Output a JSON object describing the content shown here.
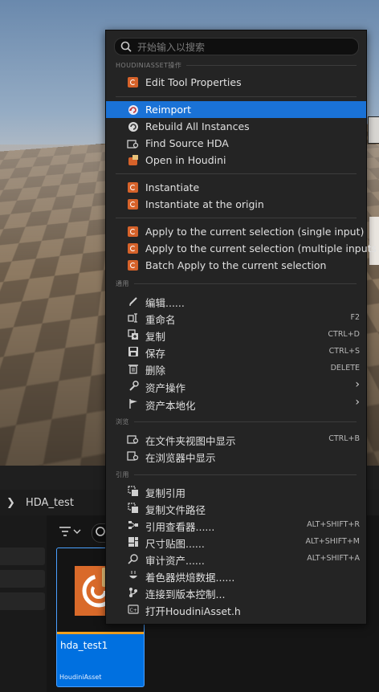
{
  "viewport": {},
  "content_browser": {
    "breadcrumb": "HDA_test",
    "asset": {
      "name": "hda_test1",
      "type": "HoudiniAsset"
    }
  },
  "menu": {
    "search_placeholder": "开始输入以搜索",
    "section_houdini": "HOUDINIASSET操作",
    "section_common": "通用",
    "section_browse": "浏览",
    "section_reference": "引用",
    "items": [
      {
        "label": "Edit Tool Properties",
        "icon": "houdini-icon",
        "shortcut": ""
      },
      {
        "label": "Reimport",
        "icon": "reimport-icon",
        "shortcut": ""
      },
      {
        "label": "Rebuild All Instances",
        "icon": "rebuild-icon",
        "shortcut": ""
      },
      {
        "label": "Find Source HDA",
        "icon": "folder-search-icon",
        "shortcut": ""
      },
      {
        "label": "Open in Houdini",
        "icon": "houdini-open-icon",
        "shortcut": ""
      },
      {
        "label": "Instantiate",
        "icon": "houdini-icon",
        "shortcut": ""
      },
      {
        "label": "Instantiate at the origin",
        "icon": "houdini-icon",
        "shortcut": ""
      },
      {
        "label": "Apply to the current selection (single input)",
        "icon": "houdini-icon",
        "shortcut": ""
      },
      {
        "label": "Apply to the current selection (multiple inputs )",
        "icon": "houdini-icon",
        "shortcut": ""
      },
      {
        "label": "Batch Apply to the current selection",
        "icon": "houdini-icon",
        "shortcut": ""
      },
      {
        "label": "编辑......",
        "icon": "pencil-icon",
        "shortcut": ""
      },
      {
        "label": "重命名",
        "icon": "rename-icon",
        "shortcut": "F2"
      },
      {
        "label": "复制",
        "icon": "duplicate-icon",
        "shortcut": "CTRL+D"
      },
      {
        "label": "保存",
        "icon": "save-icon",
        "shortcut": "CTRL+S"
      },
      {
        "label": "删除",
        "icon": "trash-icon",
        "shortcut": "DELETE"
      },
      {
        "label": "资产操作",
        "icon": "wrench-icon",
        "shortcut": ""
      },
      {
        "label": "资产本地化",
        "icon": "flag-icon",
        "shortcut": ""
      },
      {
        "label": "在文件夹视图中显示",
        "icon": "folder-search-icon",
        "shortcut": "CTRL+B"
      },
      {
        "label": "在浏览器中显示",
        "icon": "browser-search-icon",
        "shortcut": ""
      },
      {
        "label": "复制引用",
        "icon": "copy-reference-icon",
        "shortcut": ""
      },
      {
        "label": "复制文件路径",
        "icon": "copy-path-icon",
        "shortcut": ""
      },
      {
        "label": "引用查看器......",
        "icon": "reference-viewer-icon",
        "shortcut": "ALT+SHIFT+R"
      },
      {
        "label": "尺寸贴图......",
        "icon": "size-map-icon",
        "shortcut": "ALT+SHIFT+M"
      },
      {
        "label": "审计资产......",
        "icon": "audit-icon",
        "shortcut": "ALT+SHIFT+A"
      },
      {
        "label": "着色器烘焙数据......",
        "icon": "shader-icon",
        "shortcut": ""
      },
      {
        "label": "连接到版本控制...",
        "icon": "source-control-icon",
        "shortcut": ""
      },
      {
        "label": "打开HoudiniAsset.h",
        "icon": "cpp-icon",
        "shortcut": ""
      }
    ]
  }
}
